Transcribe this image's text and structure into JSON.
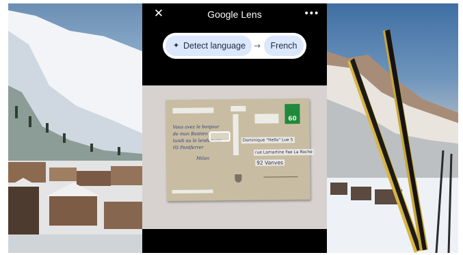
{
  "header": {
    "close_icon": "close-icon",
    "title": "Google Lens",
    "more_icon": "more-options-icon"
  },
  "translate_bar": {
    "source_label": "Detect language",
    "source_icon": "sparkle-icon",
    "arrow_icon": "arrow-right-icon",
    "target_label": "French"
  },
  "postcard": {
    "stamp_value": "60",
    "handwriting": [
      "Vous avez le bonjour",
      "de mon Bastien",
      "lundi ou le lendemain",
      "05 Pontferrer",
      "Milan"
    ],
    "address_lines": [
      "Dominique \"Hello\" Lue 5",
      "rue Lamartine Fae La Roche",
      "92 Vanves"
    ]
  },
  "colors": {
    "pill_bg": "#dbe7fb",
    "stamp": "#1f8a3a"
  }
}
